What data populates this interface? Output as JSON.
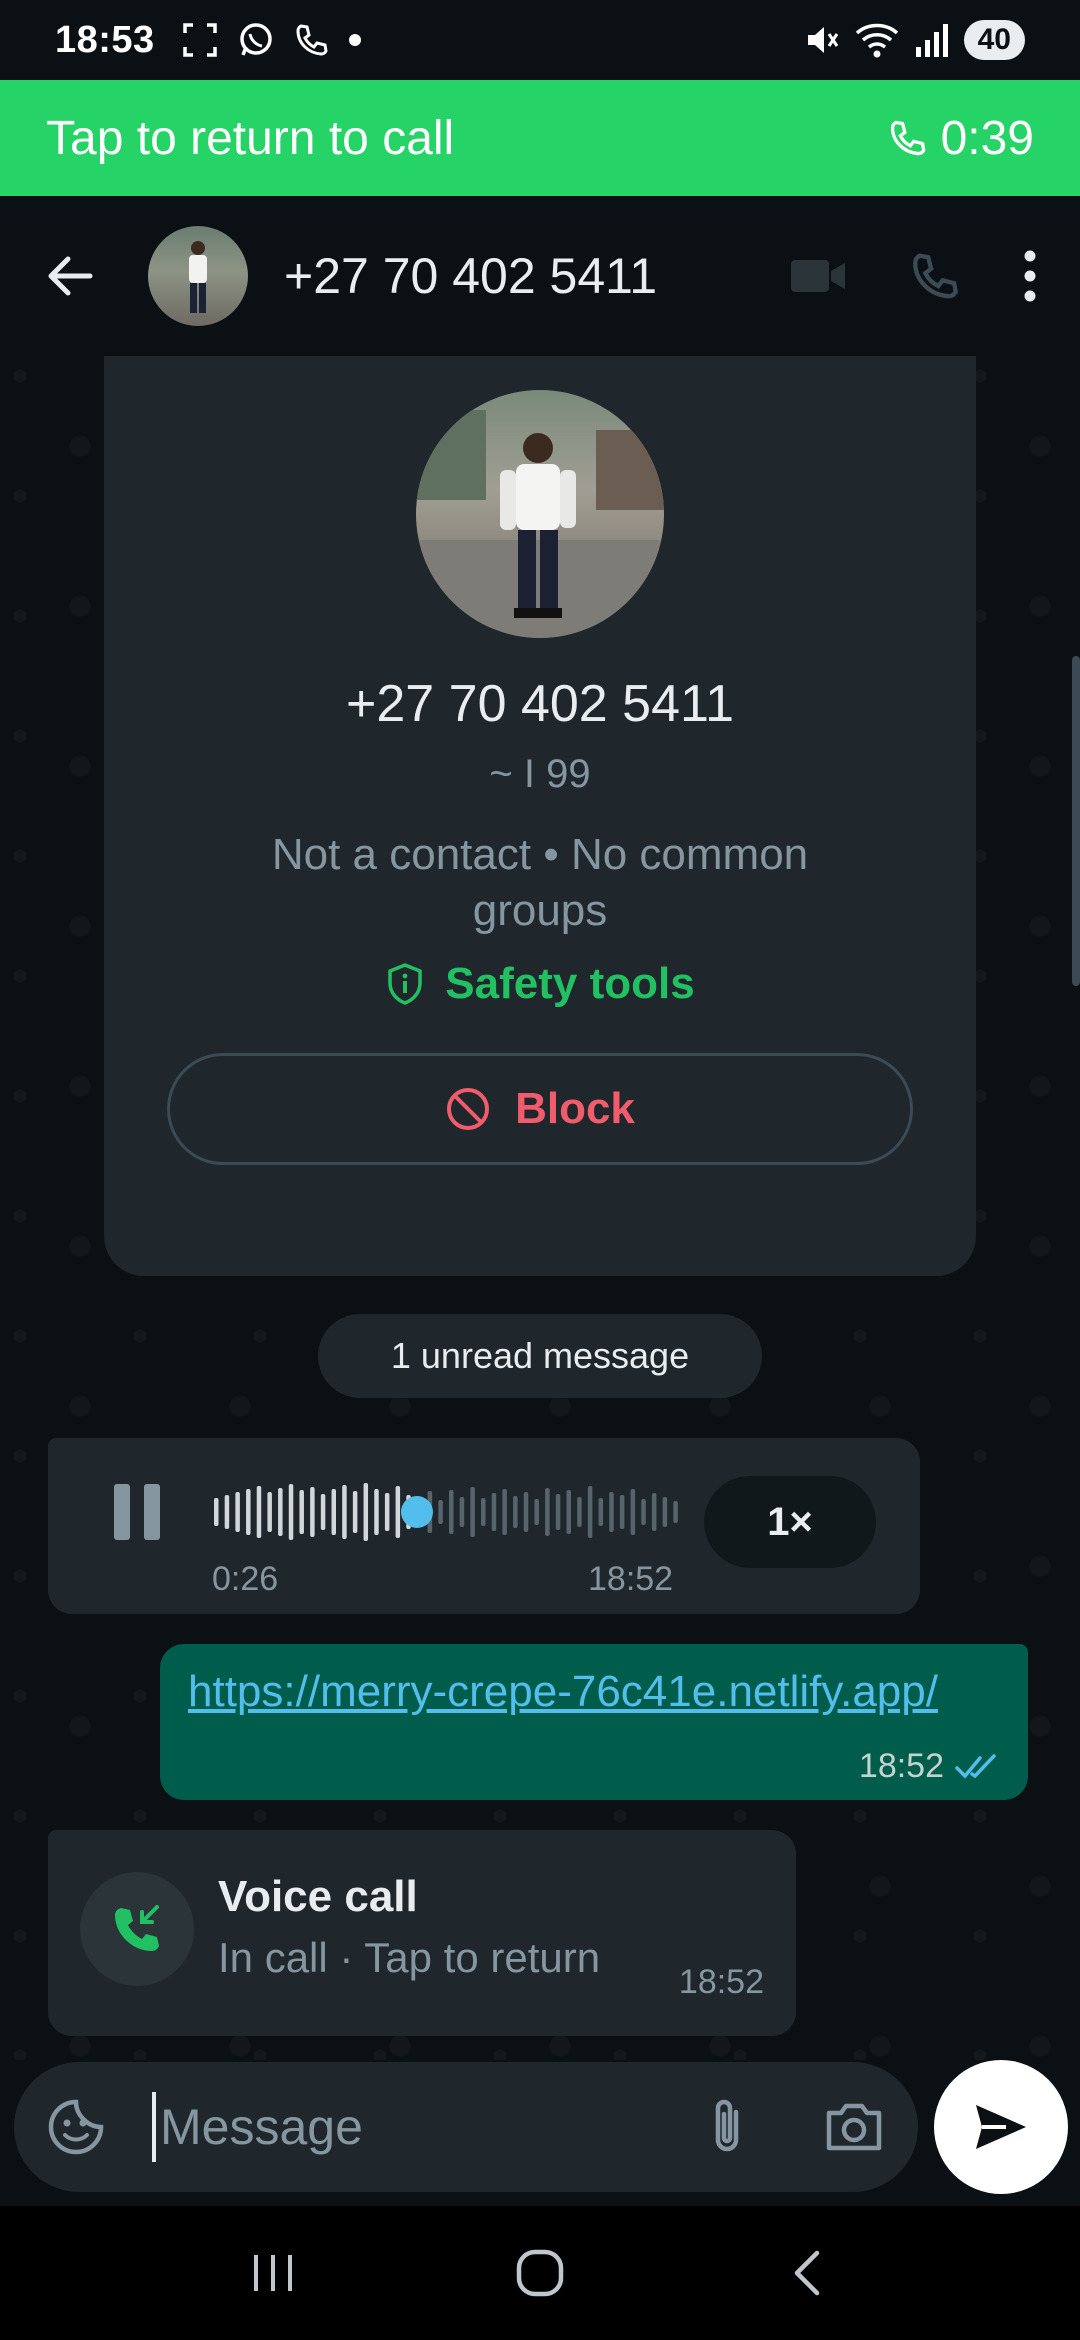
{
  "status_bar": {
    "time": "18:53",
    "battery": "40",
    "icons": [
      "screenshot-icon",
      "whatsapp-icon",
      "phone-icon",
      "dot-icon",
      "mute-icon",
      "wifi-icon",
      "signal-icon"
    ]
  },
  "call_banner": {
    "label": "Tap to return to call",
    "timer": "0:39",
    "color": "#25d366"
  },
  "header": {
    "contact_number": "+27 70 402 5411",
    "icons": [
      "back-arrow-icon",
      "video-call-icon",
      "voice-call-icon",
      "more-vert-icon"
    ]
  },
  "info_card": {
    "number": "+27 70 402 5411",
    "pushname": "~ I 99",
    "meta": "Not a contact • No common groups",
    "safety_label": "Safety tools",
    "block_label": "Block"
  },
  "unread": {
    "label": "1 unread message"
  },
  "voice_message": {
    "duration": "0:26",
    "time": "18:52",
    "speed": "1×",
    "progress": 0.43
  },
  "link_message": {
    "text": "https://merry-crepe-76c41e.netlify.app/",
    "time": "18:52",
    "status": "read"
  },
  "call_message": {
    "title": "Voice call",
    "subtitle": "In call · Tap to return",
    "time": "18:52"
  },
  "composer": {
    "placeholder": "Message"
  },
  "colors": {
    "accent_green": "#21c063",
    "outgoing_bubble": "#005c4b",
    "incoming_bubble": "#1f272c",
    "block_red": "#f15c6d",
    "link_blue": "#53bdeb"
  }
}
